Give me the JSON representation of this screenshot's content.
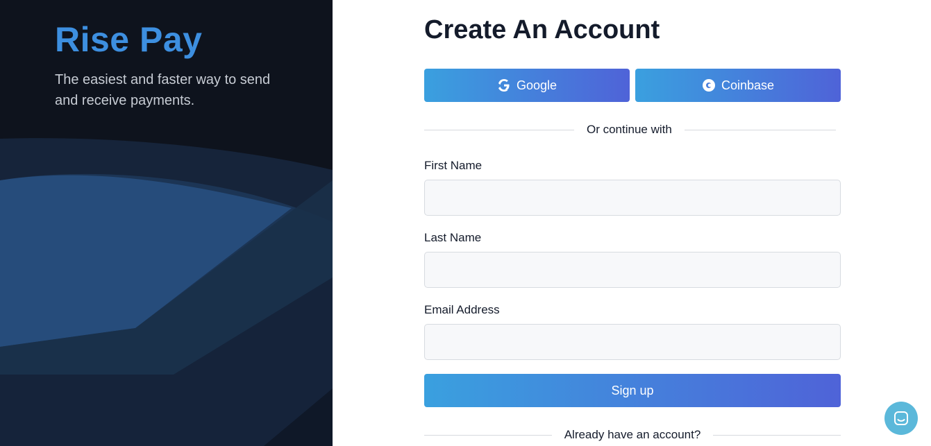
{
  "brand": {
    "name": "Rise Pay",
    "tagline": "The easiest and faster way to send and receive payments."
  },
  "form": {
    "title": "Create An Account",
    "oauth": {
      "google_label": "Google",
      "coinbase_label": "Coinbase"
    },
    "divider_text": "Or continue with",
    "fields": {
      "first_name": {
        "label": "First Name",
        "value": "",
        "placeholder": ""
      },
      "last_name": {
        "label": "Last Name",
        "value": "",
        "placeholder": ""
      },
      "email": {
        "label": "Email Address",
        "value": "",
        "placeholder": ""
      }
    },
    "submit_label": "Sign up",
    "login_prompt": "Already have an account?"
  },
  "colors": {
    "brand_blue": "#3d8fe0",
    "gradient_start": "#3aa0df",
    "gradient_end": "#4f63d8",
    "dark_panel": "#0e131d",
    "chat_bubble": "#5bb8da"
  },
  "icons": {
    "google": "google-icon",
    "coinbase": "coinbase-icon",
    "chat": "chat-icon"
  }
}
